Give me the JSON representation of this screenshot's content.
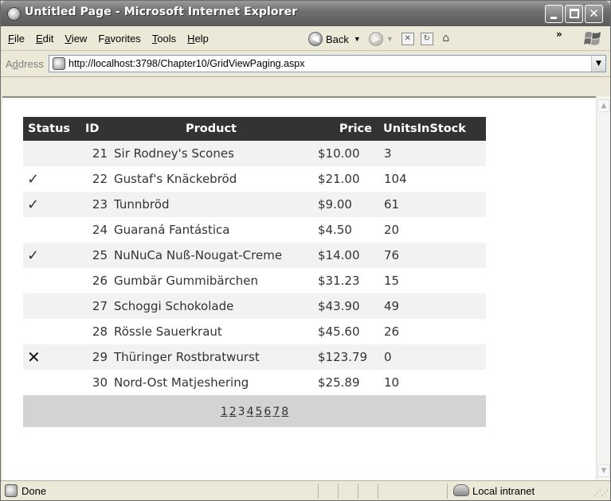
{
  "window": {
    "title": "Untitled Page - Microsoft Internet Explorer"
  },
  "menu": {
    "items": [
      {
        "key": "F",
        "rest": "ile"
      },
      {
        "key": "E",
        "rest": "dit"
      },
      {
        "key": "V",
        "rest": "iew"
      },
      {
        "pre": "F",
        "key": "a",
        "rest": "vorites"
      },
      {
        "key": "T",
        "rest": "ools"
      },
      {
        "key": "H",
        "rest": "elp"
      }
    ]
  },
  "toolbar": {
    "back_label": "Back",
    "chevron": "»"
  },
  "address": {
    "label": "Address",
    "url": "http://localhost:3798/Chapter10/GridViewPaging.aspx"
  },
  "grid": {
    "headers": {
      "status": "Status",
      "id": "ID",
      "product": "Product",
      "price": "Price",
      "units": "UnitsInStock"
    },
    "rows": [
      {
        "status": "",
        "id": "21",
        "product": "Sir Rodney's Scones",
        "price": "$10.00",
        "units": "3"
      },
      {
        "status": "✓",
        "id": "22",
        "product": "Gustaf's Knäckebröd",
        "price": "$21.00",
        "units": "104"
      },
      {
        "status": "✓",
        "id": "23",
        "product": "Tunnbröd",
        "price": "$9.00",
        "units": "61"
      },
      {
        "status": "",
        "id": "24",
        "product": "Guaraná Fantástica",
        "price": "$4.50",
        "units": "20"
      },
      {
        "status": "✓",
        "id": "25",
        "product": "NuNuCa Nuß-Nougat-Creme",
        "price": "$14.00",
        "units": "76"
      },
      {
        "status": "",
        "id": "26",
        "product": "Gumbär Gummibärchen",
        "price": "$31.23",
        "units": "15"
      },
      {
        "status": "",
        "id": "27",
        "product": "Schoggi Schokolade",
        "price": "$43.90",
        "units": "49"
      },
      {
        "status": "",
        "id": "28",
        "product": "Rössle Sauerkraut",
        "price": "$45.60",
        "units": "26"
      },
      {
        "status": "✕",
        "id": "29",
        "product": "Thüringer Rostbratwurst",
        "price": "$123.79",
        "units": "0"
      },
      {
        "status": "",
        "id": "30",
        "product": "Nord-Ost Matjeshering",
        "price": "$25.89",
        "units": "10"
      }
    ],
    "pager": {
      "pages": [
        "1",
        "2",
        "3",
        "4",
        "5",
        "6",
        "7",
        "8"
      ],
      "current": "3"
    }
  },
  "statusbar": {
    "text": "Done",
    "zone": "Local intranet"
  }
}
